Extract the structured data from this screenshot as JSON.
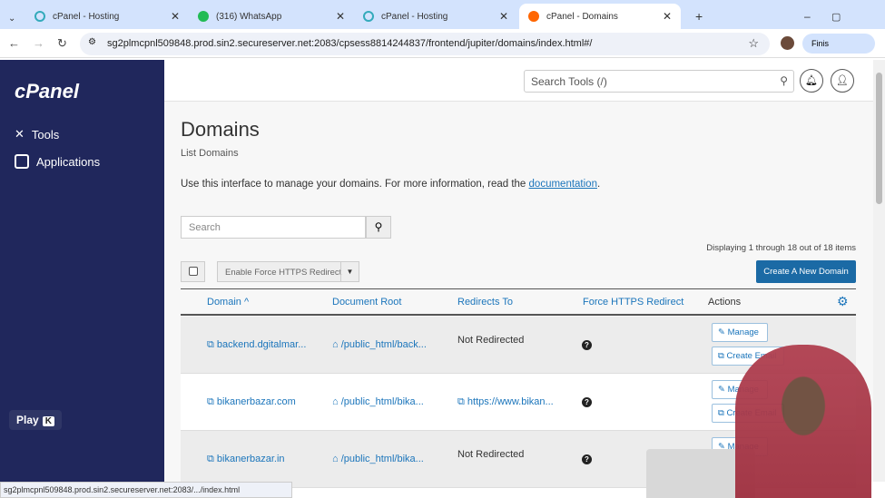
{
  "browser": {
    "tabs": [
      {
        "title": "cPanel - Hosting"
      },
      {
        "title": "(316) WhatsApp"
      },
      {
        "title": "cPanel - Hosting"
      },
      {
        "title": "cPanel - Domains",
        "active": true
      }
    ],
    "url": "sg2plmcpnl509848.prod.sin2.secureserver.net:2083/cpsess8814244837/frontend/jupiter/domains/index.html#/",
    "profile_label": "Finis",
    "status_url": "sg2plmcpnl509848.prod.sin2.secureserver.net:2083/.../index.html"
  },
  "sidebar": {
    "logo": "cPanel",
    "items": [
      {
        "label": "Tools",
        "icon": "tools-icon"
      },
      {
        "label": "Applications",
        "icon": "applications-icon"
      }
    ],
    "play_label": "Play",
    "play_key": "K"
  },
  "header": {
    "search_placeholder": "Search Tools (/)"
  },
  "page": {
    "title": "Domains",
    "subtitle": "List Domains",
    "intro": "Use this interface to manage your domains. For more information, read the",
    "intro_link": "documentation",
    "intro_end": ".",
    "search_placeholder": "Search",
    "display_info": "Displaying 1 through 18 out of 18 items",
    "bulk_action": "Enable Force HTTPS Redirect",
    "create_button": "Create A New Domain"
  },
  "table": {
    "headers": [
      "Domain",
      "Document Root",
      "Redirects To",
      "Force HTTPS Redirect",
      "Actions"
    ],
    "rows": [
      {
        "domain": "backend.dgitalmar...",
        "root": "/public_html/back...",
        "redirect": "Not Redirected",
        "actions": [
          "Manage",
          "Create Email"
        ]
      },
      {
        "domain": "bikanerbazar.com",
        "root": "/public_html/bika...",
        "redirect": "https://www.bikan...",
        "actions": [
          "Manage",
          "Create Email"
        ]
      },
      {
        "domain": "bikanerbazar.in",
        "root": "/public_html/bika...",
        "redirect": "Not Redirected",
        "actions": [
          "Manage"
        ]
      }
    ]
  },
  "colors": {
    "sidebar": "#20275c",
    "link": "#1b75bb",
    "primary_button": "#1b6aa5"
  }
}
